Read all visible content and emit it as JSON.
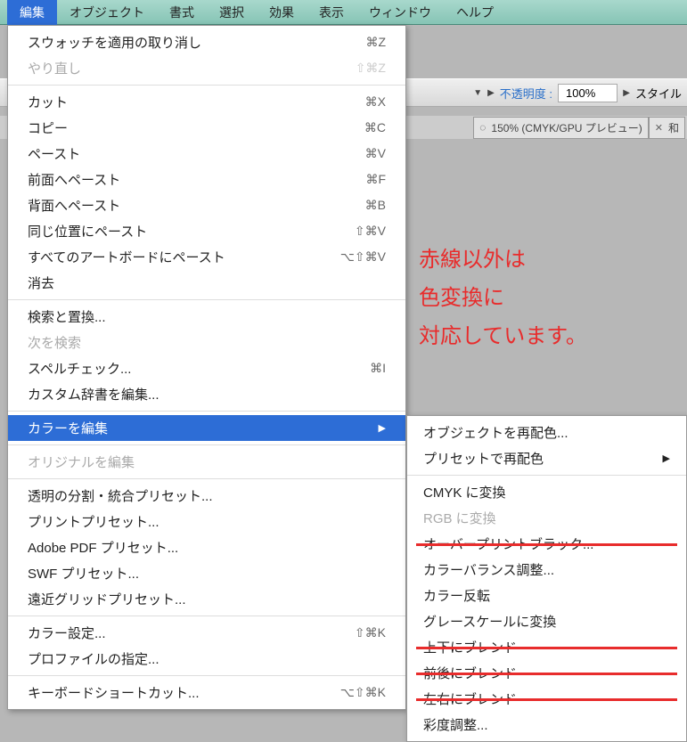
{
  "menubar": {
    "items": [
      {
        "label": "編集",
        "active": true
      },
      {
        "label": "オブジェクト"
      },
      {
        "label": "書式"
      },
      {
        "label": "選択"
      },
      {
        "label": "効果"
      },
      {
        "label": "表示"
      },
      {
        "label": "ウィンドウ"
      },
      {
        "label": "ヘルプ"
      }
    ]
  },
  "toolbar": {
    "opacity_label": "不透明度 :",
    "opacity_value": "100%",
    "style_label": "スタイル"
  },
  "doctab": {
    "title": "150% (CMYK/GPU プレビュー)",
    "next": "和"
  },
  "menu": {
    "groups": [
      [
        {
          "label": "スウォッチを適用の取り消し",
          "shortcut": "⌘Z"
        },
        {
          "label": "やり直し",
          "shortcut": "⇧⌘Z",
          "disabled": true
        }
      ],
      [
        {
          "label": "カット",
          "shortcut": "⌘X"
        },
        {
          "label": "コピー",
          "shortcut": "⌘C"
        },
        {
          "label": "ペースト",
          "shortcut": "⌘V"
        },
        {
          "label": "前面へペースト",
          "shortcut": "⌘F"
        },
        {
          "label": "背面へペースト",
          "shortcut": "⌘B"
        },
        {
          "label": "同じ位置にペースト",
          "shortcut": "⇧⌘V"
        },
        {
          "label": "すべてのアートボードにペースト",
          "shortcut": "⌥⇧⌘V"
        },
        {
          "label": "消去"
        }
      ],
      [
        {
          "label": "検索と置換..."
        },
        {
          "label": "次を検索",
          "disabled": true
        },
        {
          "label": "スペルチェック...",
          "shortcut": "⌘I"
        },
        {
          "label": "カスタム辞書を編集..."
        }
      ],
      [
        {
          "label": "カラーを編集",
          "highlight": true,
          "arrow": true
        }
      ],
      [
        {
          "label": "オリジナルを編集",
          "disabled": true
        }
      ],
      [
        {
          "label": "透明の分割・統合プリセット..."
        },
        {
          "label": "プリントプリセット..."
        },
        {
          "label": "Adobe PDF プリセット..."
        },
        {
          "label": "SWF プリセット..."
        },
        {
          "label": "遠近グリッドプリセット..."
        }
      ],
      [
        {
          "label": "カラー設定...",
          "shortcut": "⇧⌘K"
        },
        {
          "label": "プロファイルの指定..."
        }
      ],
      [
        {
          "label": "キーボードショートカット...",
          "shortcut": "⌥⇧⌘K"
        }
      ]
    ]
  },
  "submenu": {
    "groups": [
      [
        {
          "label": "オブジェクトを再配色..."
        },
        {
          "label": "プリセットで再配色",
          "arrow": true
        }
      ],
      [
        {
          "label": "CMYK に変換"
        },
        {
          "label": "RGB に変換",
          "disabled": true
        },
        {
          "label": "オーバープリントブラック...",
          "strike": true
        },
        {
          "label": "カラーバランス調整..."
        },
        {
          "label": "カラー反転"
        },
        {
          "label": "グレースケールに変換"
        },
        {
          "label": "上下にブレンド",
          "strike": true
        },
        {
          "label": "前後にブレンド",
          "strike": true
        },
        {
          "label": "左右にブレンド",
          "strike": true
        },
        {
          "label": "彩度調整..."
        }
      ]
    ]
  },
  "annotation": {
    "line1": "赤線以外は",
    "line2": "色変換に",
    "line3": "対応しています。"
  }
}
